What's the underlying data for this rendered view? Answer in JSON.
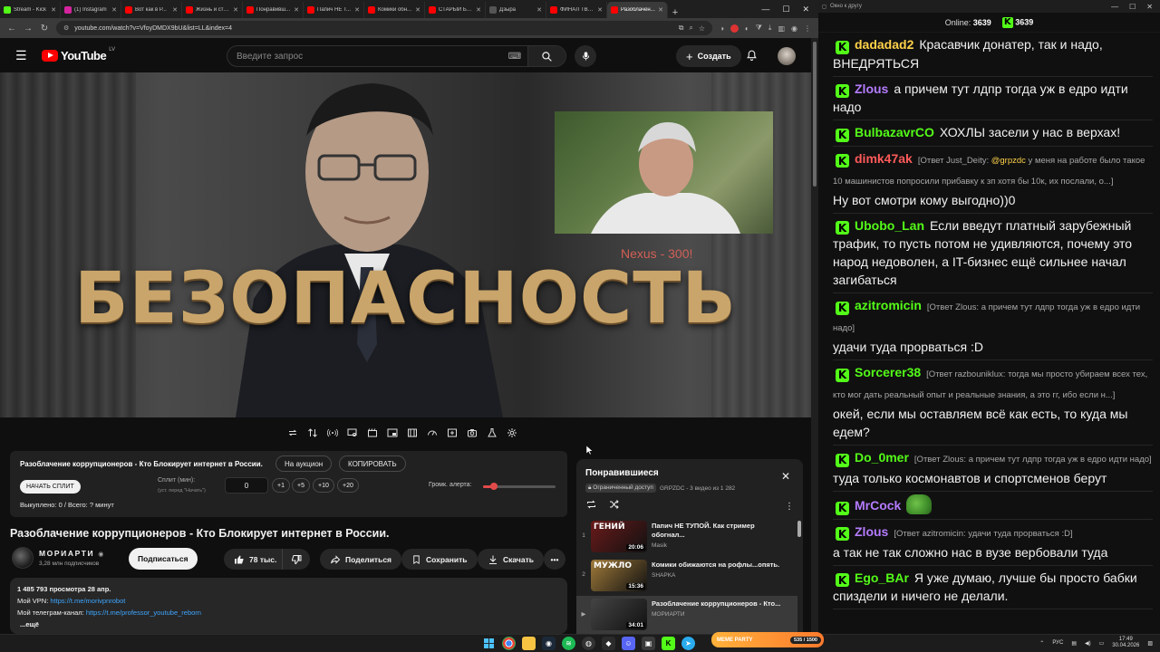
{
  "browser": {
    "tabs": [
      {
        "title": "Stream - Kick",
        "color": "#53fc18"
      },
      {
        "title": "(1) Instagram",
        "color": "#d6249f"
      },
      {
        "title": "Вот как в Р...",
        "color": "#ff0000"
      },
      {
        "title": "Жизнь и стр...",
        "color": "#ff0000"
      },
      {
        "title": "Понравивш...",
        "color": "#ff0000"
      },
      {
        "title": "Папич НЕ Т...",
        "color": "#ff0000"
      },
      {
        "title": "Комики обн...",
        "color": "#ff0000"
      },
      {
        "title": "СТАРЫЙ БОЕ...",
        "color": "#ff0000"
      },
      {
        "title": "Дзыра",
        "color": "#555555"
      },
      {
        "title": "ФИНАЛ ТВИ...",
        "color": "#ff0000"
      },
      {
        "title": "Разоблачен...",
        "color": "#ff0000",
        "active": true
      }
    ],
    "url": "youtube.com/watch?v=VfoyDMDX9bU&list=LL&index=4"
  },
  "youtube": {
    "logo": "YouTube",
    "region": "LV",
    "search_placeholder": "Введите запрос",
    "create_label": "Создать"
  },
  "video": {
    "overlay_title": "БЕЗОПАСНОСТЬ",
    "donation_text": "Nexus - 300!"
  },
  "auction": {
    "video_title": "Разоблачение коррупционеров - Кто Блокирует интернет в России.",
    "on_auction_label": "На аукцион",
    "copy_label": "КОПИРОВАТЬ",
    "start_split_label": "НАЧАТЬ СПЛИТ",
    "split_label": "Сплит (мин):",
    "split_sub": "(уст. перед \"Начать\")",
    "split_value": "0",
    "increments": [
      "+1",
      "+5",
      "+10",
      "+20"
    ],
    "volume_label": "Громк. алерта:",
    "volume_level": 0.15,
    "spent": "Выкуплено: 0 / Всего: ? минут"
  },
  "watch": {
    "title": "Разоблачение коррупционеров - Кто Блокирует интернет в России.",
    "channel": "МОРИАРТИ",
    "subs": "3,28 млн подписчиков",
    "subscribe": "Подписаться",
    "likes": "78 тыс.",
    "share": "Поделиться",
    "save": "Сохранить",
    "download": "Скачать",
    "views_date": "1 485 793 просмотра  28 апр.",
    "vpn_label": "Мой VPN: ",
    "vpn_link": "https://t.me/morivpnrobot",
    "tg_label": "Мой телеграм-канал: ",
    "tg_link": "https://t.me/professor_youtube_reborn",
    "more": "...ещё"
  },
  "playlist": {
    "title": "Понравившиеся",
    "access": "Ограниченный доступ",
    "meta": "GRPZDC - 3 видео из 1 282",
    "items": [
      {
        "index": "1",
        "title": "Папич НЕ ТУПОЙ. Как стример обогнал...",
        "channel": "Masik",
        "duration": "20:06",
        "thumb_label": "ГЕНИЙ",
        "thumb_color": "#6a1a1a"
      },
      {
        "index": "2",
        "title": "Комики обижаются на рофлы...опять.",
        "channel": "SHAPKA",
        "duration": "15:36",
        "thumb_label": "МУЖЛО",
        "thumb_color": "#a07a3a"
      },
      {
        "index": "▶",
        "title": "Разоблачение коррупционеров - Кто...",
        "channel": "МОРИАРТИ",
        "duration": "34:01",
        "thumb_label": "",
        "thumb_color": "#444444",
        "active": true
      }
    ]
  },
  "chat": {
    "window_title": "Окно к другу",
    "online_label": "Online: ",
    "online_count": "3639",
    "kick_count": "3639",
    "messages": [
      {
        "user": "dadadad2",
        "color": "#ffd24a",
        "text": "Красавчик донатер, так и надо, ВНЕДРЯТЬСЯ"
      },
      {
        "user": "Zlous",
        "color": "#b57cff",
        "text": "а причем тут лдпр тогда уж в едро идти надо"
      },
      {
        "user": "BulbazavrCO",
        "color": "#53fc18",
        "text": "ХОХЛЫ засели у нас в верхах!"
      },
      {
        "user": "dimk47ak",
        "color": "#ff5a5a",
        "reply_prefix": "[Ответ Just_Deity: ",
        "reply_mention": "@grpzdc",
        "reply_rest": " у меня на работе было такое 10 машинистов попросили прибавку к зп хотя бы 10к, их послали, о...]",
        "text": "Ну вот смотри кому выгодно))0"
      },
      {
        "user": "Ubobo_Lan",
        "color": "#53fc18",
        "text": "Если введут платный зарубежный трафик, то пусть потом не удивляются, почему это народ недоволен, а IT-бизнес ещё сильнее начал загибаться"
      },
      {
        "user": "azitromicin",
        "color": "#53fc18",
        "reply_prefix": "[Ответ Zlous: а причем тут лдпр тогда уж в едро идти надо]",
        "text": "удачи туда прорваться :D"
      },
      {
        "user": "Sorcerer38",
        "color": "#53fc18",
        "reply_prefix": "[Ответ razbouniklux: тогда мы просто убираем всех тех, кто мог дать реальный опыт и реальные знания, а это гг, ибо если н...]",
        "text": "окей, если мы оставляем всё как есть, то куда мы едем?"
      },
      {
        "user": "Do_0mer",
        "color": "#53fc18",
        "reply_prefix": "[Ответ Zlous: а причем тут лдпр тогда уж в едро идти надо]",
        "text": "туда только космонавтов и спортсменов берут"
      },
      {
        "user": "MrCock",
        "color": "#b57cff",
        "text": "",
        "emote": true
      },
      {
        "user": "Zlous",
        "color": "#b57cff",
        "reply_prefix": "[Ответ azitromicin: удачи туда прорваться :D]",
        "text": "а так не так сложно нас в вузе вербовали туда"
      },
      {
        "user": "Ego_BAr",
        "color": "#53fc18",
        "text": "Я уже думаю, лучше бы просто бабки спиздели и ничего не делали."
      }
    ]
  },
  "taskbar": {
    "meme_label": "MEME PARTY",
    "meme_progress": "535 / 1500",
    "lang": "РУС",
    "time": "17:49",
    "date": "30.04.2026"
  }
}
